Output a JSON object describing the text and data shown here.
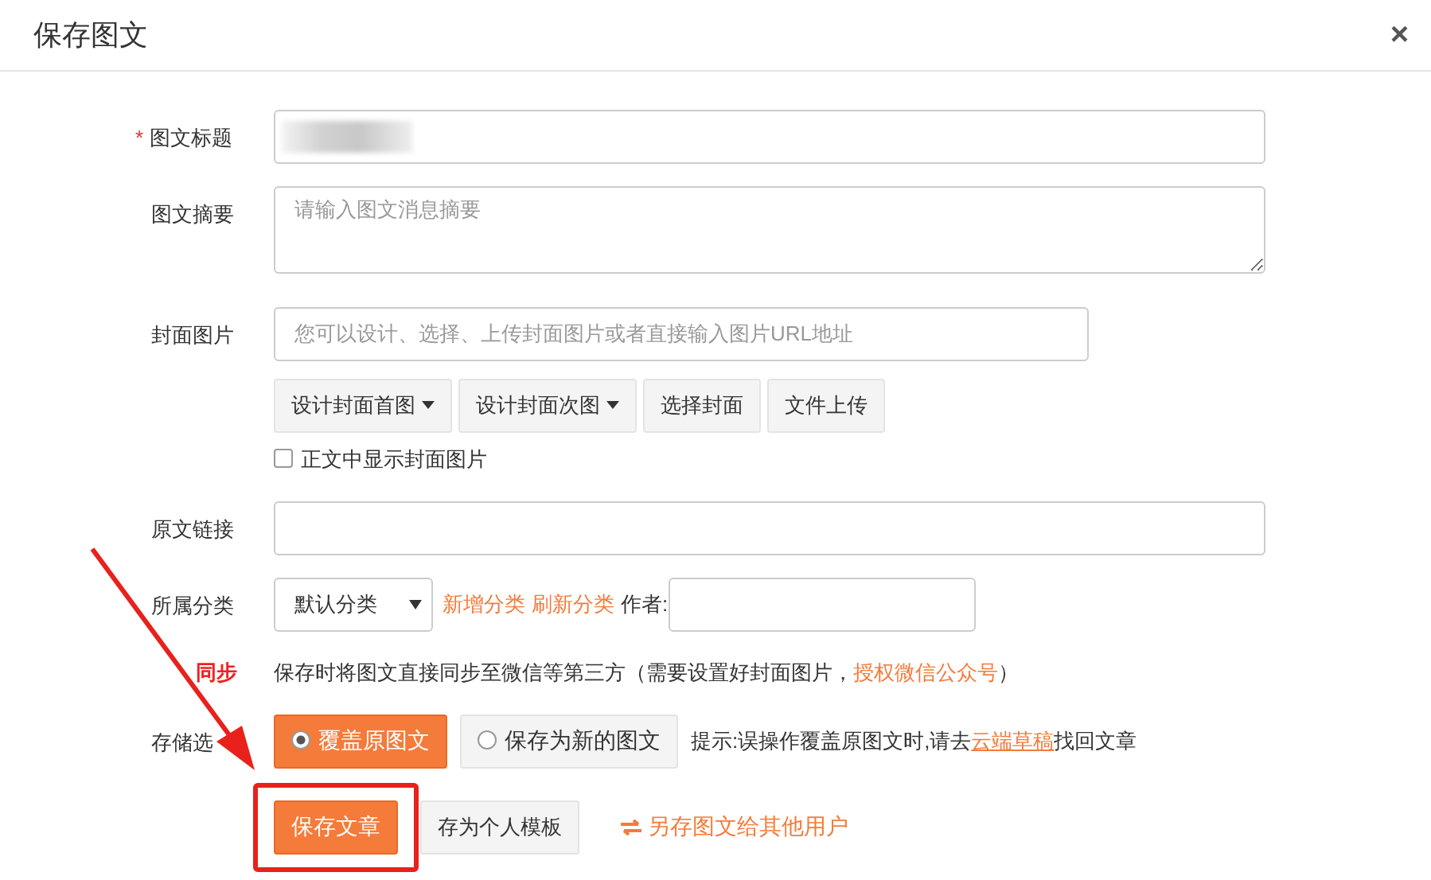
{
  "title": "保存图文",
  "close": "×",
  "title_field": {
    "label": "图文标题",
    "required_mark": "*"
  },
  "summary_field": {
    "label": "图文摘要",
    "placeholder": "请输入图文消息摘要"
  },
  "cover": {
    "label": "封面图片",
    "placeholder": "您可以设计、选择、上传封面图片或者直接输入图片URL地址",
    "buttons": [
      {
        "label": "设计封面首图",
        "dropdown": true
      },
      {
        "label": "设计封面次图",
        "dropdown": true
      },
      {
        "label": "选择封面",
        "dropdown": false
      },
      {
        "label": "文件上传",
        "dropdown": false
      }
    ],
    "show_in_body": {
      "label": "正文中显示封面图片",
      "checked": false
    }
  },
  "source_link": {
    "label": "原文链接"
  },
  "category": {
    "label": "所属分类",
    "select": "默认分类",
    "links": [
      "新增分类",
      "刷新分类"
    ],
    "author_label": "作者:"
  },
  "sync": {
    "label": "同步",
    "text": "保存时将图文直接同步至微信等第三方（需要设置好封面图片，",
    "link": "授权微信公众号",
    "text_end": "）"
  },
  "storage": {
    "label": "存储选",
    "options": [
      {
        "label": "覆盖原图文",
        "selected": true
      },
      {
        "label": "保存为新的图文",
        "selected": false
      }
    ],
    "hint": "提示:误操作覆盖原图文时,请去",
    "hint_link": "云端草稿",
    "hint_end": "找回文章"
  },
  "actions": [
    {
      "label": "保存文章",
      "kind": "primary",
      "highlighted": true
    },
    {
      "label": "存为个人模板",
      "kind": "default",
      "highlighted": false
    },
    {
      "label": "另存图文给其他用户",
      "kind": "link",
      "highlighted": false
    }
  ]
}
